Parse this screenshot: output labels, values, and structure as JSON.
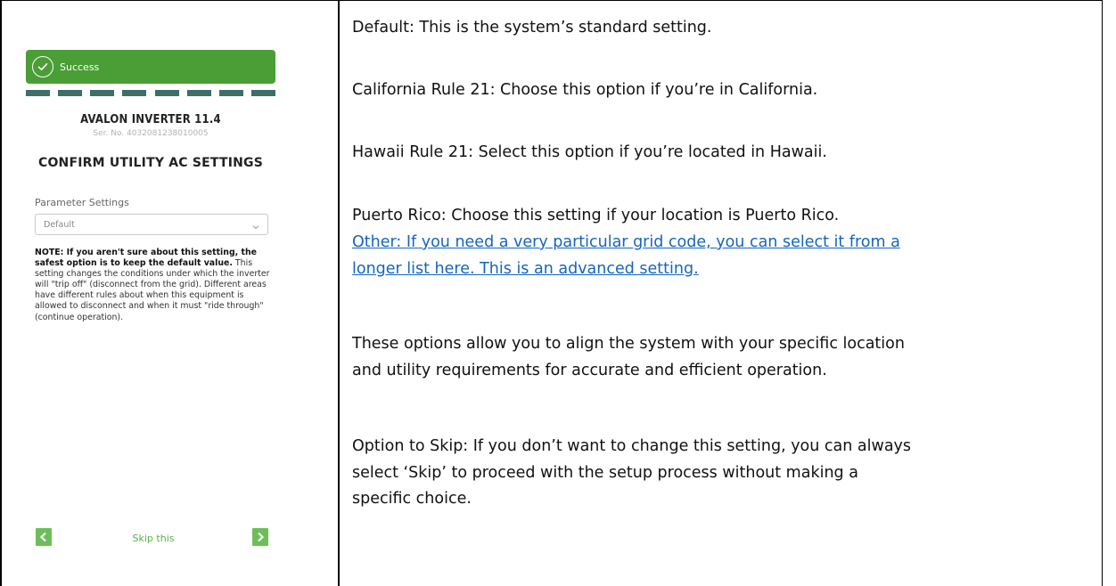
{
  "app": {
    "toast": {
      "text": "Success",
      "icon": "check-circle-icon"
    },
    "device_name": "AVALON INVERTER 11.4",
    "serial": "Ser. No. 4032081238010005",
    "screen_title": "CONFIRM UTILITY AC SETTINGS",
    "parameter_label": "Parameter Settings",
    "parameter_value": "Default",
    "note": {
      "bold": "NOTE: If you aren't sure about this setting, the safest option is to keep the default value.",
      "body": " This setting changes the conditions under which the inverter will \"trip off\" (disconnect from the grid). Different areas have different rules about when this equipment is allowed to disconnect and when it must \"ride through\" (continue operation)."
    },
    "skip_label": "Skip this",
    "back_icon": "chevron-left-icon",
    "next_icon": "chevron-right-icon",
    "colors": {
      "accent_green": "#4a9e35",
      "dash": "#3f6e69",
      "nav_button": "#6cbf58",
      "skip_text": "#59b14a"
    }
  },
  "doc": {
    "default": "Default: This is the system’s standard setting.",
    "california": "California Rule 21: Choose this option if you’re in California.",
    "hawaii": "Hawaii Rule 21: Select this option if you’re located in Hawaii.",
    "puerto_rico": "Puerto Rico: Choose this setting if your location is Puerto Rico.",
    "other_line1": "Other: If you need a very particular grid code, you can select it from a",
    "other_line2": "longer list here.  This is an advanced setting.",
    "options_line1": "These options allow you to align the system with your specific location",
    "options_line2": "and utility requirements for accurate and efficient operation.",
    "skip_line1": "Option to Skip: If you don’t want to change this setting, you can always",
    "skip_line2": "select ‘Skip’ to proceed with the setup process without making a",
    "skip_line3": "specific choice.",
    "link_color": "#1565c0"
  }
}
